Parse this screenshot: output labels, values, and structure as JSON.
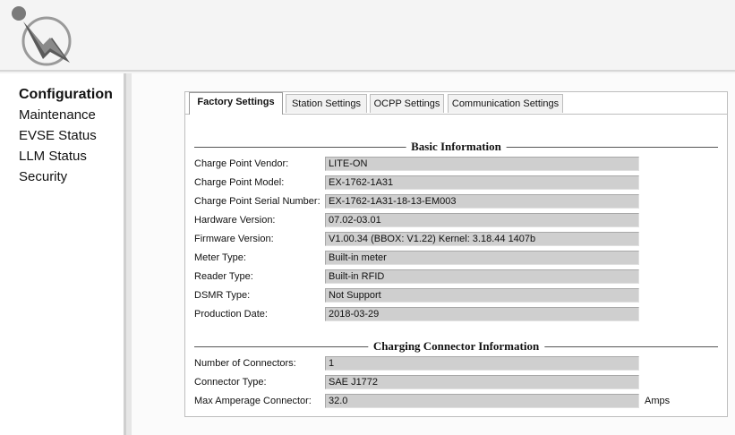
{
  "nav": {
    "items": [
      {
        "label": "Configuration",
        "active": true
      },
      {
        "label": "Maintenance",
        "active": false
      },
      {
        "label": "EVSE Status",
        "active": false
      },
      {
        "label": "LLM Status",
        "active": false
      },
      {
        "label": "Security",
        "active": false
      }
    ]
  },
  "tabs": [
    {
      "label": "Factory Settings",
      "active": true
    },
    {
      "label": "Station Settings",
      "active": false
    },
    {
      "label": "OCPP Settings",
      "active": false
    },
    {
      "label": "Communication Settings",
      "active": false
    }
  ],
  "basic_info": {
    "title": "Basic Information",
    "fields": [
      {
        "label": "Charge Point Vendor:",
        "value": "LITE-ON"
      },
      {
        "label": "Charge Point Model:",
        "value": "EX-1762-1A31"
      },
      {
        "label": "Charge Point Serial Number:",
        "value": "EX-1762-1A31-18-13-EM003"
      },
      {
        "label": "Hardware Version:",
        "value": "07.02-03.01"
      },
      {
        "label": "Firmware Version:",
        "value": "V1.00.34 (BBOX: V1.22) Kernel: 3.18.44 1407b"
      },
      {
        "label": "Meter Type:",
        "value": "Built-in meter"
      },
      {
        "label": "Reader Type:",
        "value": "Built-in RFID"
      },
      {
        "label": "DSMR Type:",
        "value": "Not Support"
      },
      {
        "label": "Production Date:",
        "value": "2018-03-29"
      }
    ]
  },
  "connector_info": {
    "title": "Charging Connector Information",
    "fields": [
      {
        "label": "Number of Connectors:",
        "value": "1"
      },
      {
        "label": "Connector Type:",
        "value": "SAE J1772"
      },
      {
        "label": "Max Amperage Connector:",
        "value": "32.0",
        "unit": "Amps"
      }
    ]
  },
  "colors": {
    "field_bg": "#cfcfcf",
    "logo_red": "#c0392b",
    "logo_gray": "#6e6e6e"
  }
}
